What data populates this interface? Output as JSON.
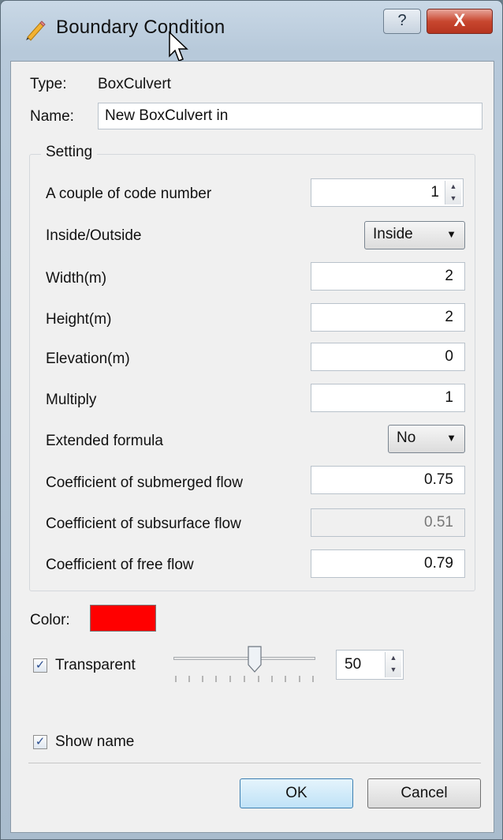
{
  "window": {
    "title": "Boundary Condition",
    "help_glyph": "?",
    "close_glyph": "X"
  },
  "type_row": {
    "label": "Type:",
    "value": "BoxCulvert"
  },
  "name_row": {
    "label": "Name:",
    "value": "New BoxCulvert in"
  },
  "setting": {
    "title": "Setting",
    "code_number": {
      "label": "A couple of code number",
      "value": "1"
    },
    "inside_outside": {
      "label": "Inside/Outside",
      "value": "Inside"
    },
    "width": {
      "label": "Width(m)",
      "value": "2"
    },
    "height": {
      "label": "Height(m)",
      "value": "2"
    },
    "elevation": {
      "label": "Elevation(m)",
      "value": "0"
    },
    "multiply": {
      "label": "Multiply",
      "value": "1"
    },
    "extended_formula": {
      "label": "Extended formula",
      "value": "No"
    },
    "submerged": {
      "label": "Coefficient of submerged flow",
      "value": "0.75"
    },
    "subsurface": {
      "label": "Coefficient of subsurface flow",
      "value": "0.51"
    },
    "free": {
      "label": "Coefficient of free flow",
      "value": "0.79"
    }
  },
  "color": {
    "label": "Color:",
    "value": "#ff0000"
  },
  "transparent": {
    "label": "Transparent",
    "checked": true,
    "value": "50",
    "slider_fraction": 0.5
  },
  "show_name": {
    "label": "Show name",
    "checked": true
  },
  "buttons": {
    "ok": "OK",
    "cancel": "Cancel"
  },
  "icons": {
    "title": "pencil-icon",
    "spin_up": "▲",
    "spin_down": "▼",
    "combo_arrow": "▼",
    "check": "✓"
  }
}
